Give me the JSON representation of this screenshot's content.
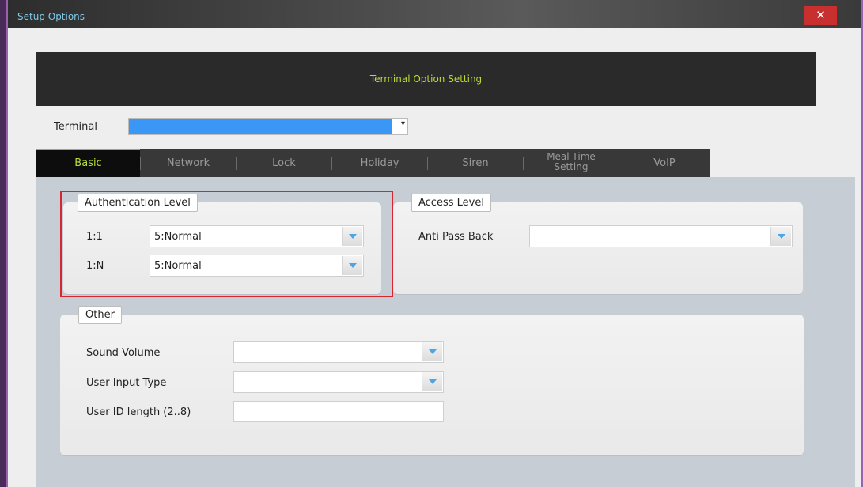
{
  "window": {
    "title": "Setup Options",
    "close_glyph": "✕"
  },
  "header": {
    "title": "Terminal Option Setting"
  },
  "terminal": {
    "label": "Terminal",
    "selected": "",
    "arrow": "▾"
  },
  "tabs": [
    {
      "label": "Basic",
      "active": true
    },
    {
      "label": "Network",
      "active": false
    },
    {
      "label": "Lock",
      "active": false
    },
    {
      "label": "Holiday",
      "active": false
    },
    {
      "label": "Siren",
      "active": false
    },
    {
      "label": "Meal Time\nSetting",
      "active": false
    },
    {
      "label": "VoIP",
      "active": false
    }
  ],
  "auth": {
    "caption": "Authentication Level",
    "rows": [
      {
        "label": "1:1",
        "value": "5:Normal"
      },
      {
        "label": "1:N",
        "value": "5:Normal"
      }
    ]
  },
  "access": {
    "caption": "Access Level",
    "anti_pass_back": {
      "label": "Anti Pass Back",
      "value": ""
    }
  },
  "other": {
    "caption": "Other",
    "sound_volume": {
      "label": "Sound Volume",
      "value": ""
    },
    "user_input_type": {
      "label": "User Input Type",
      "value": ""
    },
    "user_id_length": {
      "label": "User ID length (2..8)",
      "value": ""
    }
  },
  "colors": {
    "accent_green": "#b7dc35",
    "selection_blue": "#3b97f5",
    "close_red": "#c7302f",
    "highlight_red": "#d9252d",
    "title_blue": "#7fc8e8"
  }
}
